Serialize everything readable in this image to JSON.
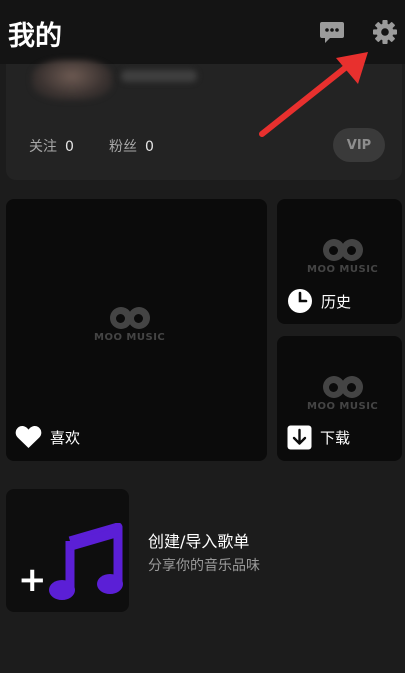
{
  "header": {
    "title": "我的",
    "message_icon": "chat-bubble-icon",
    "settings_icon": "gear-icon"
  },
  "profile": {
    "follow_label": "关注",
    "follow_count": "0",
    "fans_label": "粉丝",
    "fans_count": "0",
    "vip_label": "VIP"
  },
  "tiles": {
    "watermark": "MOO MUSIC",
    "favorites_label": "喜欢",
    "history_label": "历史",
    "downloads_label": "下载"
  },
  "create_playlist": {
    "title": "创建/导入歌单",
    "subtitle": "分享你的音乐品味",
    "plus_symbol": "+"
  },
  "colors": {
    "background": "#1c1c1c",
    "card": "#232323",
    "tile": "#0b0b0b",
    "music_note": "#5b1fd6",
    "annotation": "#e8302e"
  }
}
